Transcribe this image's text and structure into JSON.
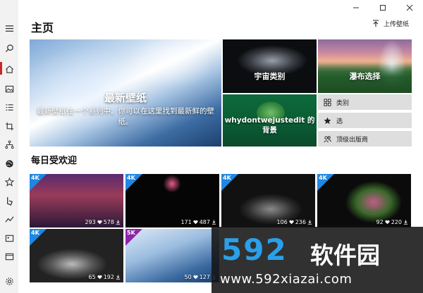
{
  "header": {
    "title": "主页",
    "upload_label": "上传壁纸"
  },
  "rail": {
    "icons": [
      "menu-icon",
      "search-icon",
      "home-icon",
      "image-icon",
      "list-icon",
      "crop-icon",
      "tree-icon",
      "globe-icon",
      "star-icon",
      "bing-icon",
      "trend-icon",
      "photo-icon",
      "bookmark-icon",
      "settings-icon"
    ]
  },
  "hero": {
    "title": "最新壁纸",
    "description": "最新壁纸在一个系列中。你可以在这里找到最新鲜的壁纸。"
  },
  "tiles": {
    "universe": "宇宙类别",
    "waterfall": "瀑布选择",
    "edit": "whydontwejustedit 的背景"
  },
  "side_buttons": [
    {
      "label": "类别",
      "icon": "grid-icon"
    },
    {
      "label": "选",
      "icon": "star-icon"
    },
    {
      "label": "顶级出版商",
      "icon": "people-icon"
    }
  ],
  "popular": {
    "title": "每日受欢迎",
    "items": [
      {
        "badge": "4K",
        "likes": "293",
        "downloads": "578"
      },
      {
        "badge": "4K",
        "likes": "171",
        "downloads": "487"
      },
      {
        "badge": "4K",
        "likes": "106",
        "downloads": "236"
      },
      {
        "badge": "4K",
        "likes": "92",
        "downloads": "220"
      },
      {
        "badge": "4K",
        "likes": "65",
        "downloads": "192"
      },
      {
        "badge": "5K",
        "likes": "50",
        "downloads": "127"
      }
    ]
  },
  "watermark": {
    "logo": "592",
    "name": "软件园",
    "url": "www.592xiazai.com"
  },
  "colors": {
    "badge_4k": "#1e88e5",
    "badge_5k": "#8e24aa",
    "active_accent": "#c62828"
  }
}
